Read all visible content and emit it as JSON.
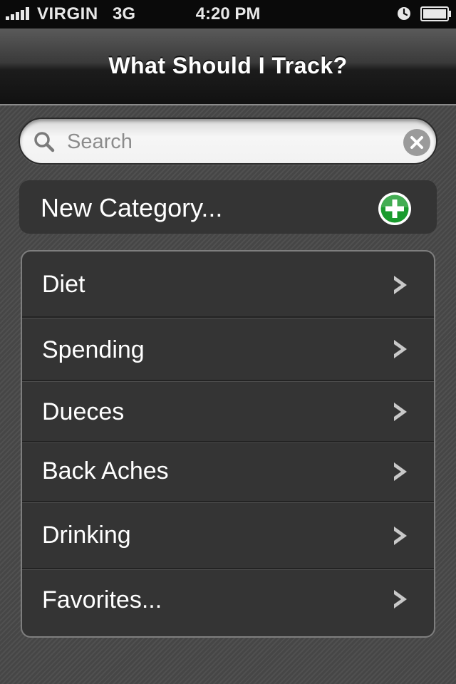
{
  "status_bar": {
    "carrier": "VIRGIN",
    "network": "3G",
    "time": "4:20 PM",
    "icons": [
      "signal-icon",
      "alarm-icon",
      "battery-icon"
    ]
  },
  "nav": {
    "title": "What Should I Track?"
  },
  "search": {
    "placeholder": "Search",
    "value": "",
    "icons": [
      "search-icon",
      "clear-icon"
    ]
  },
  "new_category": {
    "label": "New Category...",
    "icon": "add-icon",
    "icon_color": "#1a9b2e"
  },
  "categories": {
    "items": [
      {
        "label": "Diet"
      },
      {
        "label": "Spending"
      },
      {
        "label": "Dueces"
      },
      {
        "label": "Back Aches"
      },
      {
        "label": "Drinking"
      },
      {
        "label": "Favorites..."
      }
    ],
    "row_icon": "chevron-right-icon"
  }
}
